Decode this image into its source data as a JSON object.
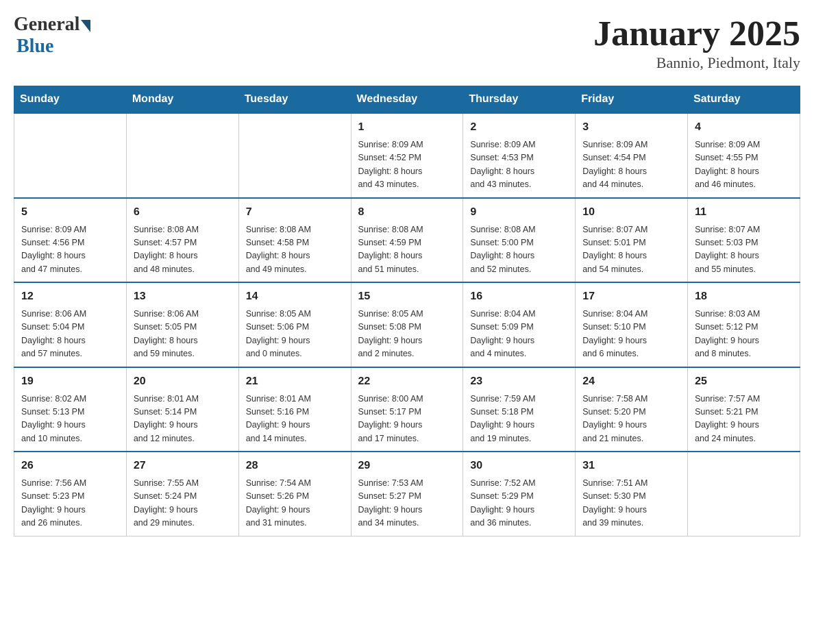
{
  "logo": {
    "general": "General",
    "blue": "Blue"
  },
  "title": "January 2025",
  "subtitle": "Bannio, Piedmont, Italy",
  "days_of_week": [
    "Sunday",
    "Monday",
    "Tuesday",
    "Wednesday",
    "Thursday",
    "Friday",
    "Saturday"
  ],
  "weeks": [
    [
      {
        "day": "",
        "info": ""
      },
      {
        "day": "",
        "info": ""
      },
      {
        "day": "",
        "info": ""
      },
      {
        "day": "1",
        "info": "Sunrise: 8:09 AM\nSunset: 4:52 PM\nDaylight: 8 hours\nand 43 minutes."
      },
      {
        "day": "2",
        "info": "Sunrise: 8:09 AM\nSunset: 4:53 PM\nDaylight: 8 hours\nand 43 minutes."
      },
      {
        "day": "3",
        "info": "Sunrise: 8:09 AM\nSunset: 4:54 PM\nDaylight: 8 hours\nand 44 minutes."
      },
      {
        "day": "4",
        "info": "Sunrise: 8:09 AM\nSunset: 4:55 PM\nDaylight: 8 hours\nand 46 minutes."
      }
    ],
    [
      {
        "day": "5",
        "info": "Sunrise: 8:09 AM\nSunset: 4:56 PM\nDaylight: 8 hours\nand 47 minutes."
      },
      {
        "day": "6",
        "info": "Sunrise: 8:08 AM\nSunset: 4:57 PM\nDaylight: 8 hours\nand 48 minutes."
      },
      {
        "day": "7",
        "info": "Sunrise: 8:08 AM\nSunset: 4:58 PM\nDaylight: 8 hours\nand 49 minutes."
      },
      {
        "day": "8",
        "info": "Sunrise: 8:08 AM\nSunset: 4:59 PM\nDaylight: 8 hours\nand 51 minutes."
      },
      {
        "day": "9",
        "info": "Sunrise: 8:08 AM\nSunset: 5:00 PM\nDaylight: 8 hours\nand 52 minutes."
      },
      {
        "day": "10",
        "info": "Sunrise: 8:07 AM\nSunset: 5:01 PM\nDaylight: 8 hours\nand 54 minutes."
      },
      {
        "day": "11",
        "info": "Sunrise: 8:07 AM\nSunset: 5:03 PM\nDaylight: 8 hours\nand 55 minutes."
      }
    ],
    [
      {
        "day": "12",
        "info": "Sunrise: 8:06 AM\nSunset: 5:04 PM\nDaylight: 8 hours\nand 57 minutes."
      },
      {
        "day": "13",
        "info": "Sunrise: 8:06 AM\nSunset: 5:05 PM\nDaylight: 8 hours\nand 59 minutes."
      },
      {
        "day": "14",
        "info": "Sunrise: 8:05 AM\nSunset: 5:06 PM\nDaylight: 9 hours\nand 0 minutes."
      },
      {
        "day": "15",
        "info": "Sunrise: 8:05 AM\nSunset: 5:08 PM\nDaylight: 9 hours\nand 2 minutes."
      },
      {
        "day": "16",
        "info": "Sunrise: 8:04 AM\nSunset: 5:09 PM\nDaylight: 9 hours\nand 4 minutes."
      },
      {
        "day": "17",
        "info": "Sunrise: 8:04 AM\nSunset: 5:10 PM\nDaylight: 9 hours\nand 6 minutes."
      },
      {
        "day": "18",
        "info": "Sunrise: 8:03 AM\nSunset: 5:12 PM\nDaylight: 9 hours\nand 8 minutes."
      }
    ],
    [
      {
        "day": "19",
        "info": "Sunrise: 8:02 AM\nSunset: 5:13 PM\nDaylight: 9 hours\nand 10 minutes."
      },
      {
        "day": "20",
        "info": "Sunrise: 8:01 AM\nSunset: 5:14 PM\nDaylight: 9 hours\nand 12 minutes."
      },
      {
        "day": "21",
        "info": "Sunrise: 8:01 AM\nSunset: 5:16 PM\nDaylight: 9 hours\nand 14 minutes."
      },
      {
        "day": "22",
        "info": "Sunrise: 8:00 AM\nSunset: 5:17 PM\nDaylight: 9 hours\nand 17 minutes."
      },
      {
        "day": "23",
        "info": "Sunrise: 7:59 AM\nSunset: 5:18 PM\nDaylight: 9 hours\nand 19 minutes."
      },
      {
        "day": "24",
        "info": "Sunrise: 7:58 AM\nSunset: 5:20 PM\nDaylight: 9 hours\nand 21 minutes."
      },
      {
        "day": "25",
        "info": "Sunrise: 7:57 AM\nSunset: 5:21 PM\nDaylight: 9 hours\nand 24 minutes."
      }
    ],
    [
      {
        "day": "26",
        "info": "Sunrise: 7:56 AM\nSunset: 5:23 PM\nDaylight: 9 hours\nand 26 minutes."
      },
      {
        "day": "27",
        "info": "Sunrise: 7:55 AM\nSunset: 5:24 PM\nDaylight: 9 hours\nand 29 minutes."
      },
      {
        "day": "28",
        "info": "Sunrise: 7:54 AM\nSunset: 5:26 PM\nDaylight: 9 hours\nand 31 minutes."
      },
      {
        "day": "29",
        "info": "Sunrise: 7:53 AM\nSunset: 5:27 PM\nDaylight: 9 hours\nand 34 minutes."
      },
      {
        "day": "30",
        "info": "Sunrise: 7:52 AM\nSunset: 5:29 PM\nDaylight: 9 hours\nand 36 minutes."
      },
      {
        "day": "31",
        "info": "Sunrise: 7:51 AM\nSunset: 5:30 PM\nDaylight: 9 hours\nand 39 minutes."
      },
      {
        "day": "",
        "info": ""
      }
    ]
  ]
}
